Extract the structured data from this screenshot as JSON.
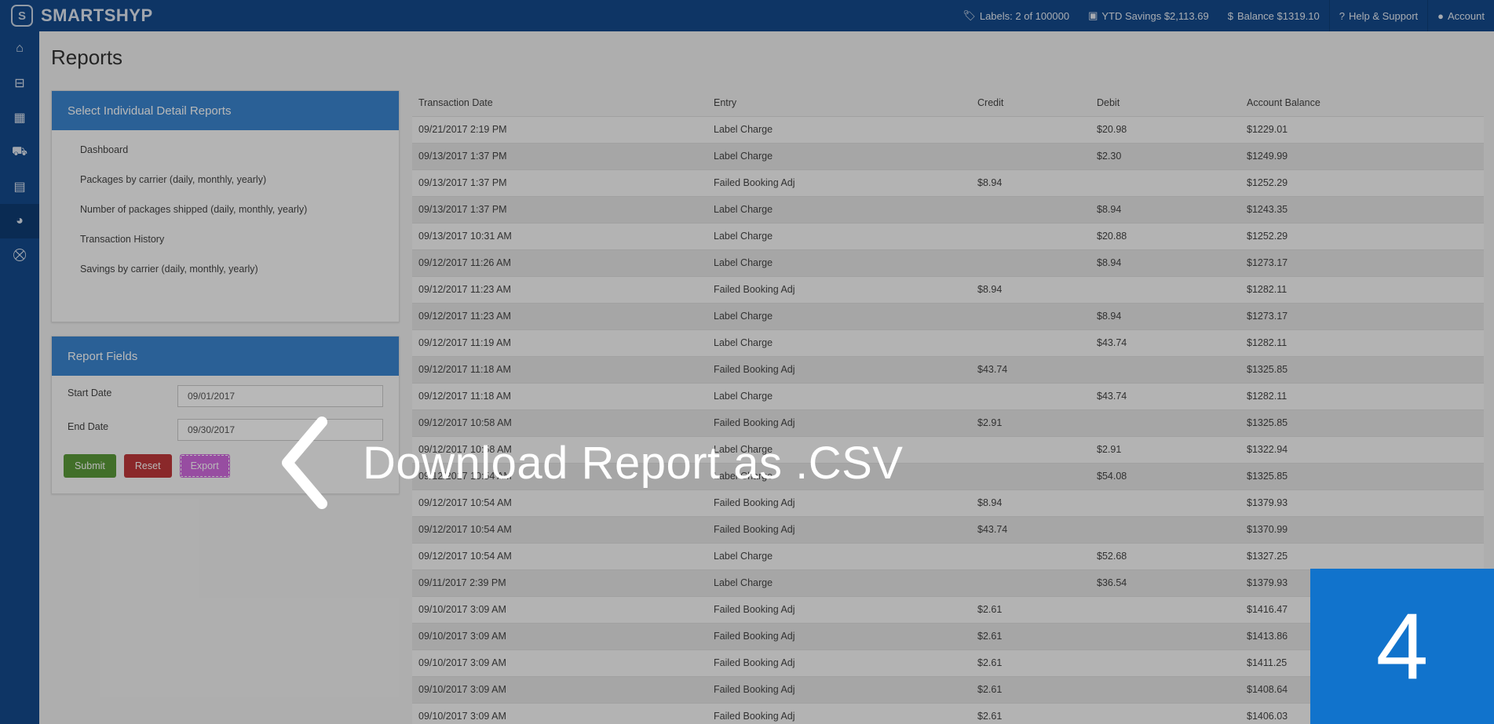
{
  "brand": {
    "name": "SMARTSHYP",
    "logo_letter": "S"
  },
  "top_bar": {
    "labels": "Labels: 2 of 100000",
    "ytd_savings": "YTD Savings $2,113.69",
    "balance": "Balance $1319.10",
    "help": "Help & Support",
    "account": "Account"
  },
  "sidebar": {
    "items": [
      {
        "icon": "home-icon"
      },
      {
        "icon": "basket-icon"
      },
      {
        "icon": "calendar-icon"
      },
      {
        "icon": "truck-icon"
      },
      {
        "icon": "address-book-icon"
      },
      {
        "icon": "pie-chart-icon"
      },
      {
        "icon": "cart-icon"
      }
    ],
    "active_icon": "pie-chart-icon"
  },
  "page": {
    "title": "Reports"
  },
  "detail_reports": {
    "heading": "Select Individual Detail Reports",
    "items": [
      "Dashboard",
      "Packages by carrier (daily, monthly, yearly)",
      "Number of packages shipped (daily, monthly, yearly)",
      "Transaction History",
      "Savings by carrier (daily, monthly, yearly)"
    ]
  },
  "report_fields": {
    "heading": "Report Fields",
    "start_label": "Start Date",
    "start_value": "09/01/2017",
    "end_label": "End Date",
    "end_value": "09/30/2017",
    "submit": "Submit",
    "reset": "Reset",
    "export": "Export"
  },
  "table": {
    "headers": [
      "Transaction Date",
      "Entry",
      "Credit",
      "Debit",
      "Account Balance"
    ],
    "rows": [
      [
        "09/21/2017 2:19 PM",
        "Label Charge",
        "",
        "$20.98",
        "$1229.01"
      ],
      [
        "09/13/2017 1:37 PM",
        "Label Charge",
        "",
        "$2.30",
        "$1249.99"
      ],
      [
        "09/13/2017 1:37 PM",
        "Failed Booking Adj",
        "$8.94",
        "",
        "$1252.29"
      ],
      [
        "09/13/2017 1:37 PM",
        "Label Charge",
        "",
        "$8.94",
        "$1243.35"
      ],
      [
        "09/13/2017 10:31 AM",
        "Label Charge",
        "",
        "$20.88",
        "$1252.29"
      ],
      [
        "09/12/2017 11:26 AM",
        "Label Charge",
        "",
        "$8.94",
        "$1273.17"
      ],
      [
        "09/12/2017 11:23 AM",
        "Failed Booking Adj",
        "$8.94",
        "",
        "$1282.11"
      ],
      [
        "09/12/2017 11:23 AM",
        "Label Charge",
        "",
        "$8.94",
        "$1273.17"
      ],
      [
        "09/12/2017 11:19 AM",
        "Label Charge",
        "",
        "$43.74",
        "$1282.11"
      ],
      [
        "09/12/2017 11:18 AM",
        "Failed Booking Adj",
        "$43.74",
        "",
        "$1325.85"
      ],
      [
        "09/12/2017 11:18 AM",
        "Label Charge",
        "",
        "$43.74",
        "$1282.11"
      ],
      [
        "09/12/2017 10:58 AM",
        "Failed Booking Adj",
        "$2.91",
        "",
        "$1325.85"
      ],
      [
        "09/12/2017 10:58 AM",
        "Label Charge",
        "",
        "$2.91",
        "$1322.94"
      ],
      [
        "09/12/2017 10:54 AM",
        "Label Charge",
        "",
        "$54.08",
        "$1325.85"
      ],
      [
        "09/12/2017 10:54 AM",
        "Failed Booking Adj",
        "$8.94",
        "",
        "$1379.93"
      ],
      [
        "09/12/2017 10:54 AM",
        "Failed Booking Adj",
        "$43.74",
        "",
        "$1370.99"
      ],
      [
        "09/12/2017 10:54 AM",
        "Label Charge",
        "",
        "$52.68",
        "$1327.25"
      ],
      [
        "09/11/2017 2:39 PM",
        "Label Charge",
        "",
        "$36.54",
        "$1379.93"
      ],
      [
        "09/10/2017 3:09 AM",
        "Failed Booking Adj",
        "$2.61",
        "",
        "$1416.47"
      ],
      [
        "09/10/2017 3:09 AM",
        "Failed Booking Adj",
        "$2.61",
        "",
        "$1413.86"
      ],
      [
        "09/10/2017 3:09 AM",
        "Failed Booking Adj",
        "$2.61",
        "",
        "$1411.25"
      ],
      [
        "09/10/2017 3:09 AM",
        "Failed Booking Adj",
        "$2.61",
        "",
        "$1408.64"
      ],
      [
        "09/10/2017 3:09 AM",
        "Failed Booking Adj",
        "$2.61",
        "",
        "$1406.03"
      ]
    ]
  },
  "overlay": {
    "callout": "Download Report as .CSV",
    "step": "4"
  },
  "colors": {
    "topbar": "#144a8c",
    "panel_header": "#3b86d0",
    "submit": "#5b9a3a",
    "reset": "#c0383b",
    "export": "#d26be0",
    "step_badge": "#1173cc"
  }
}
